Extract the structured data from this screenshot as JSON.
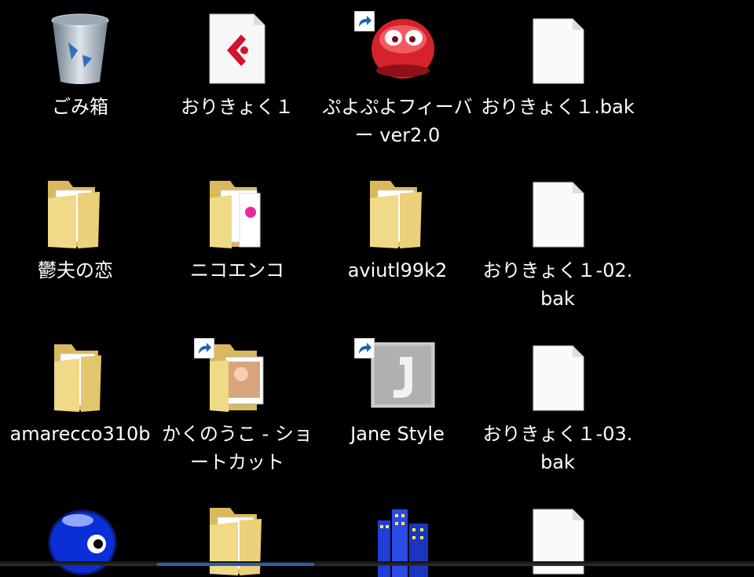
{
  "desktop": {
    "icons": [
      {
        "label": "ごみ箱"
      },
      {
        "label": "おりきょく１"
      },
      {
        "label": "ぷよぷよフィーバー ver2.0"
      },
      {
        "label": "おりきょく１.bak"
      },
      {
        "label": "鬱夫の恋"
      },
      {
        "label": "ニコエンコ"
      },
      {
        "label": "aviutl99k2"
      },
      {
        "label": "おりきょく１-02.bak"
      },
      {
        "label": "amarecco310b"
      },
      {
        "label": "かくのうこ - ショートカット"
      },
      {
        "label": "Jane Style"
      },
      {
        "label": "おりきょく１-03.bak"
      }
    ]
  },
  "colors": {
    "background": "#000000",
    "folder": "#e9cf6f",
    "label_text": "#ffffff",
    "shortcut_arrow": "#1d5fc4"
  }
}
